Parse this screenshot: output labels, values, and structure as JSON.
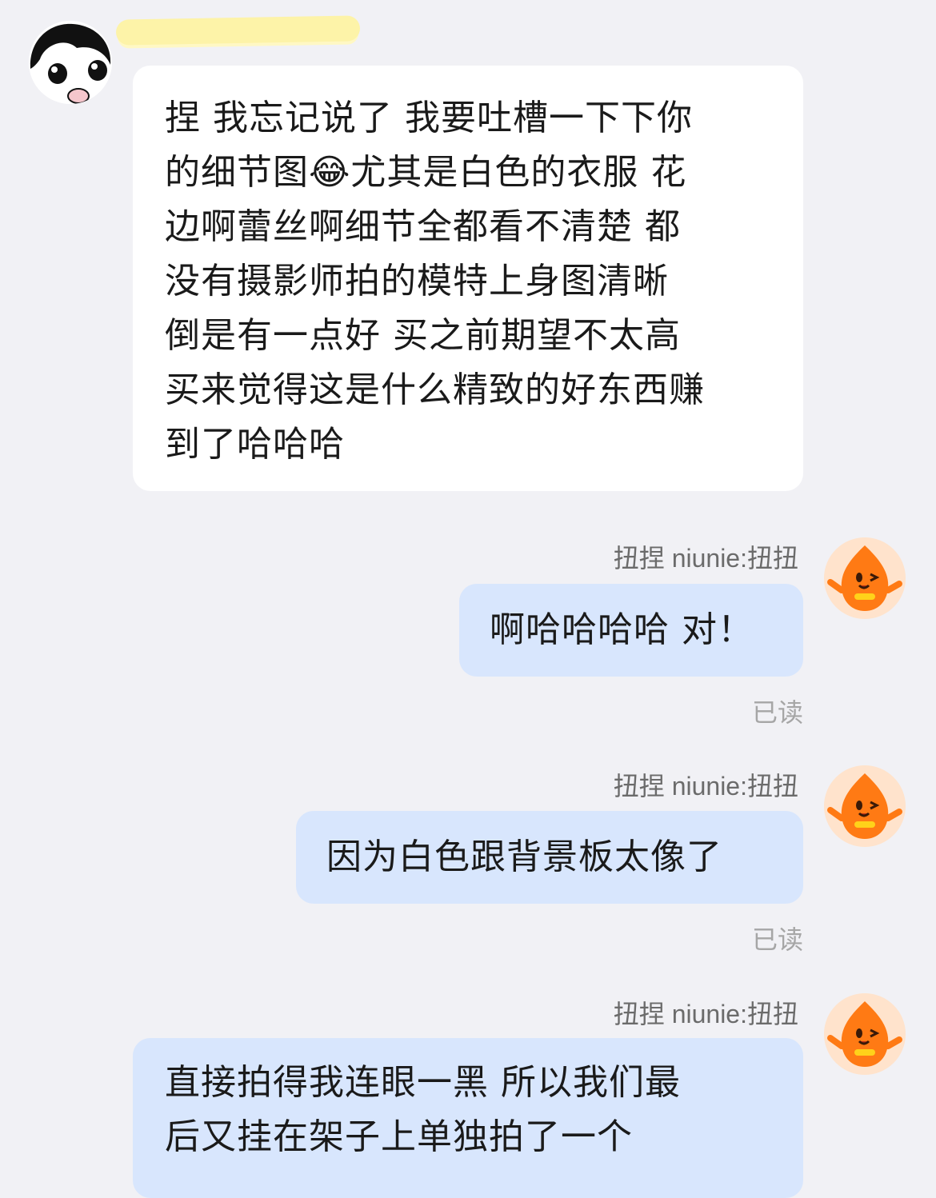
{
  "incoming": {
    "lines": [
      "捏 我忘记说了 我要吐槽一下下你",
      "的细节图😂尤其是白色的衣服 花",
      "边啊蕾丝啊细节全都看不清楚 都",
      "没有摄影师拍的模特上身图清晰",
      "倒是有一点好 买之前期望不太高",
      "买来觉得这是什么精致的好东西赚",
      "到了哈哈哈"
    ]
  },
  "outgoing": [
    {
      "sender": "扭捏 niunie:扭扭",
      "lines": [
        "啊哈哈哈哈 对！"
      ],
      "status": "已读"
    },
    {
      "sender": "扭捏 niunie:扭扭",
      "lines": [
        "因为白色跟背景板太像了"
      ],
      "status": "已读"
    },
    {
      "sender": "扭捏 niunie:扭扭",
      "lines": [
        "直接拍得我连眼一黑 所以我们最",
        "后又挂在架子上单独拍了一个"
      ]
    }
  ],
  "colors": {
    "background": "#f1f1f5",
    "incoming_bubble": "#ffffff",
    "outgoing_bubble": "#d8e6fd",
    "sender_text": "#6b6b6b",
    "read_text": "#a6a6a6",
    "name_redaction": "#fdf3a8"
  }
}
